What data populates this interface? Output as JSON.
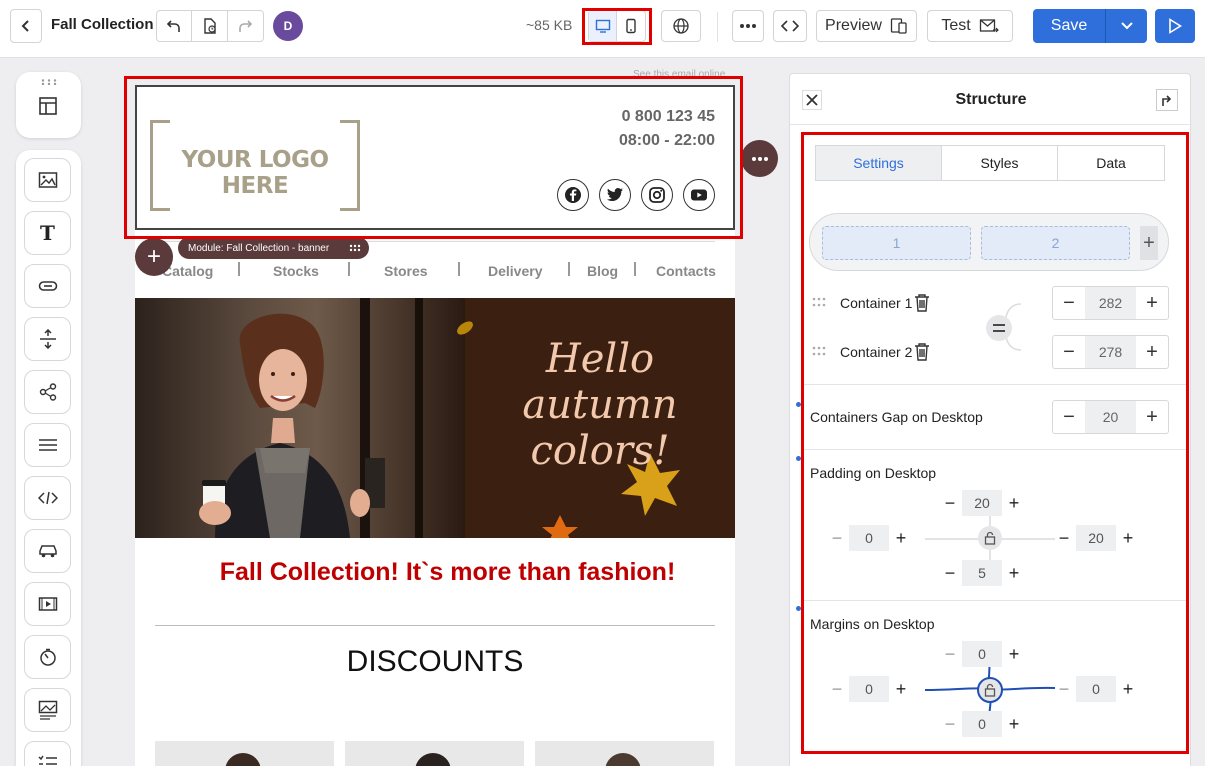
{
  "topbar": {
    "title": "Fall Collection",
    "avatar_letter": "D",
    "size": "~85 KB",
    "preview_label": "Preview",
    "test_label": "Test",
    "save_label": "Save"
  },
  "email": {
    "see_online": "See this email online",
    "logo_text": "YOUR LOGO HERE",
    "phone": "0 800 123 45",
    "hours": "08:00 - 22:00",
    "module_label": "Module: Fall Collection - banner",
    "nav": [
      "Catalog",
      "Stocks",
      "Stores",
      "Delivery",
      "Blog",
      "Contacts"
    ],
    "banner_text": [
      "Hello",
      "autumn",
      "colors!"
    ],
    "headline": "Fall Collection! It`s more than fashion!",
    "discounts": "DISCOUNTS"
  },
  "panel": {
    "title": "Structure",
    "tabs": [
      "Settings",
      "Styles",
      "Data"
    ],
    "columns": [
      "1",
      "2"
    ],
    "container1": {
      "label": "Container 1",
      "value": "282"
    },
    "container2": {
      "label": "Container 2",
      "value": "278"
    },
    "gap": {
      "label": "Containers Gap on Desktop",
      "value": "20"
    },
    "padding": {
      "label": "Padding on Desktop",
      "top": "20",
      "left": "0",
      "right": "20",
      "bottom": "5"
    },
    "margins": {
      "label": "Margins on Desktop",
      "top": "0",
      "left": "0",
      "right": "0",
      "bottom": "0"
    }
  },
  "colors": {
    "accent": "#2f6fdb",
    "headline": "#c00000",
    "highlight": "#e00000",
    "module": "#5a3a3a",
    "avatar": "#6a4a9c"
  }
}
